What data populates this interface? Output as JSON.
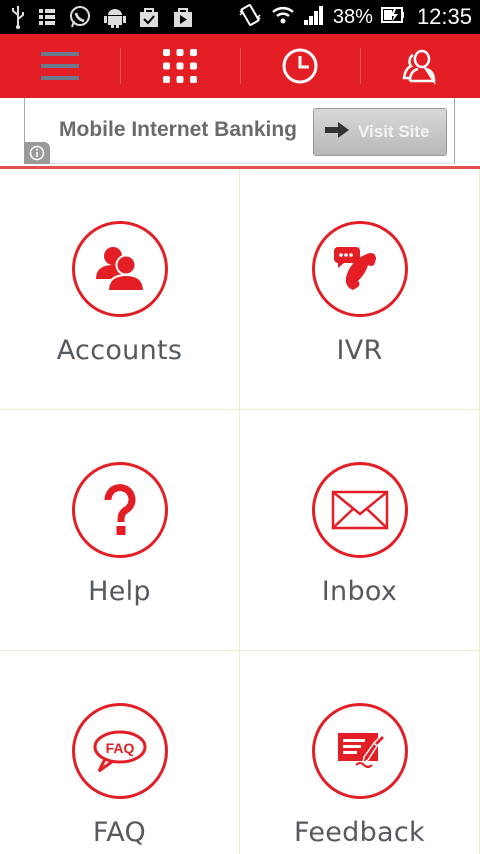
{
  "status_bar": {
    "battery": "38%",
    "time": "12:35",
    "icons": [
      "usb-icon",
      "bars-icon",
      "whatsapp-icon",
      "android-icon",
      "bag-check-icon",
      "play-store-icon",
      "vibrate-icon",
      "wifi-icon",
      "signal-icon",
      "battery-icon"
    ]
  },
  "toolbar": {
    "items": [
      {
        "name": "menu",
        "icon": "hamburger-menu-icon"
      },
      {
        "name": "apps",
        "icon": "grid-dots-icon"
      },
      {
        "name": "history",
        "icon": "clock-icon"
      },
      {
        "name": "profile",
        "icon": "users-icon"
      }
    ]
  },
  "ad": {
    "title": "Mobile Internet Banking",
    "button_label": "Visit Site",
    "info_icon": "info-icon"
  },
  "colors": {
    "accent": "#e31e24",
    "label": "#555a60",
    "divider": "#efeccc"
  },
  "tiles": [
    {
      "label": "Accounts",
      "icon": "accounts-users-icon"
    },
    {
      "label": "IVR",
      "icon": "phone-chat-icon"
    },
    {
      "label": "Help",
      "icon": "question-icon"
    },
    {
      "label": "Inbox",
      "icon": "envelope-icon"
    },
    {
      "label": "FAQ",
      "icon": "faq-bubble-icon"
    },
    {
      "label": "Feedback",
      "icon": "feedback-form-icon"
    }
  ]
}
